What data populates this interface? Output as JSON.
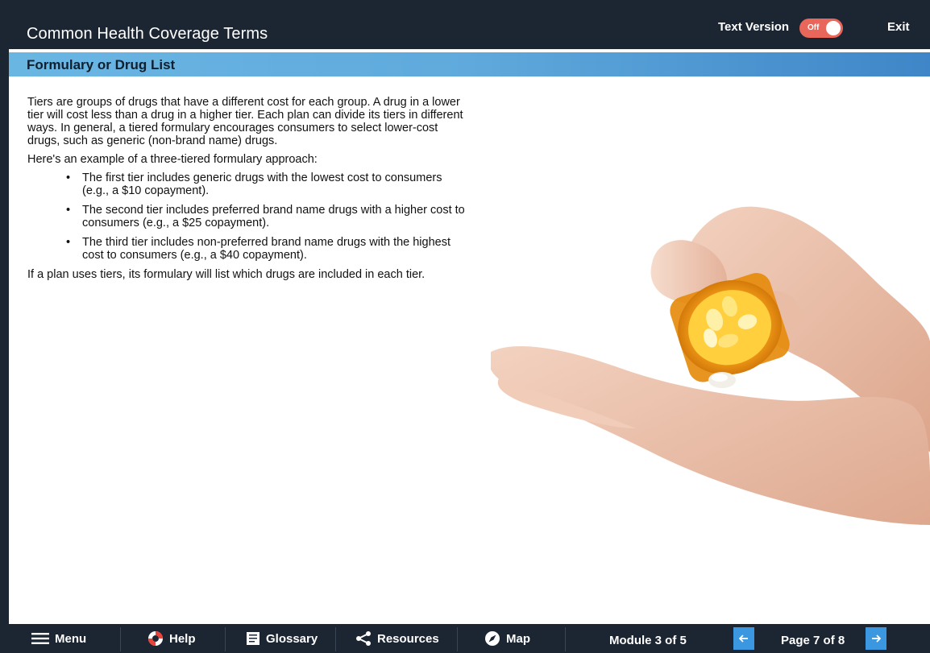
{
  "header": {
    "title": "Common Health Coverage Terms",
    "text_version_label": "Text Version",
    "toggle_state": "Off",
    "exit_label": "Exit"
  },
  "section": {
    "title": "Formulary or Drug List"
  },
  "content": {
    "paragraph1": "Tiers are groups of drugs that have a different cost for each group. A drug in a lower tier will cost less than a drug in a higher tier. Each plan can divide its tiers in different ways. In general, a tiered formulary encourages consumers to select lower-cost drugs, such as generic (non-brand name) drugs.",
    "paragraph2": "Here's an example of a three-tiered formulary approach:",
    "bullets": [
      "The first tier includes generic drugs with the lowest cost to consumers (e.g., a $10 copayment).",
      "The second tier includes preferred brand name drugs with a higher cost to consumers (e.g., a $25 copayment).",
      "The third tier includes non-preferred brand name drugs with the highest cost to consumers (e.g., a $40 copayment)."
    ],
    "paragraph3": "If a plan uses tiers, its formulary will list which drugs are included in each tier."
  },
  "footer": {
    "menu_label": "Menu",
    "help_label": "Help",
    "glossary_label": "Glossary",
    "resources_label": "Resources",
    "map_label": "Map",
    "module_indicator": "Module 3 of 5",
    "page_indicator": "Page 7 of 8",
    "prev_icon": "arrow-left-icon",
    "next_icon": "arrow-right-icon"
  },
  "colors": {
    "dark_bar": "#1c2633",
    "section_bar": "#5fa9dc",
    "toggle_off": "#e8665a",
    "nav_arrow": "#3a97e0"
  }
}
